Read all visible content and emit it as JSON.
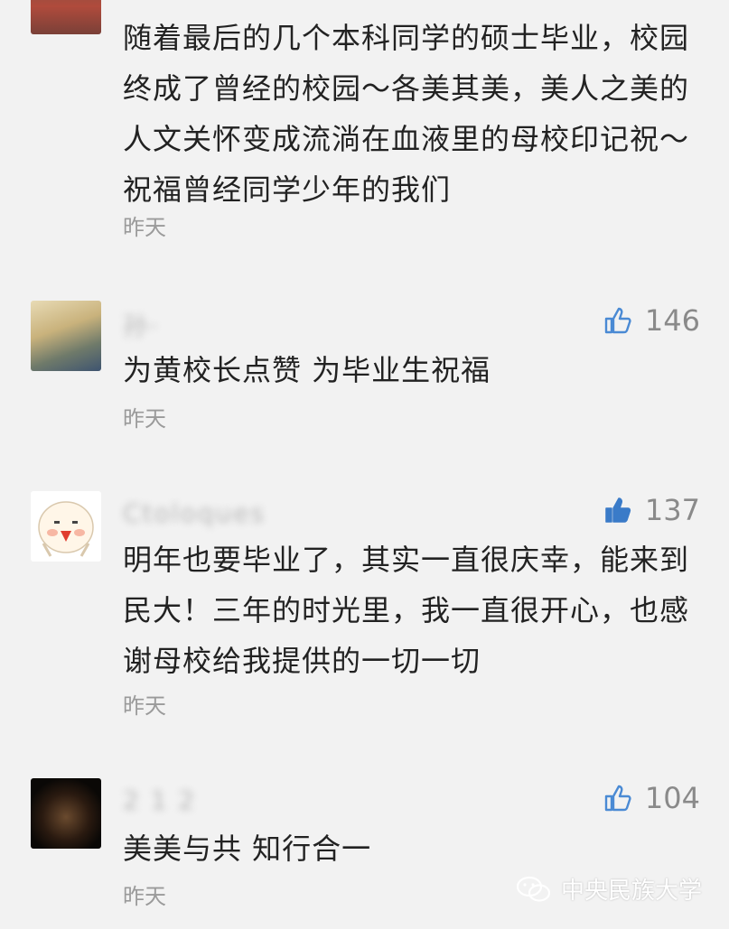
{
  "comments": [
    {
      "name": "",
      "likes": "",
      "text": "随着最后的几个本科同学的硕士毕业，校园终成了曾经的校园～各美其美，美人之美的人文关怀变成流淌在血液里的母校印记祝～祝福曾经同学少年的我们",
      "time": "昨天"
    },
    {
      "name": "孙·",
      "likes": "146",
      "text": "为黄校长点赞  为毕业生祝福",
      "time": "昨天"
    },
    {
      "name": "Ctoloques",
      "likes": "137",
      "text": "明年也要毕业了，其实一直很庆幸，能来到民大！三年的时光里，我一直很开心，也感谢母校给我提供的一切一切",
      "time": "昨天"
    },
    {
      "name": "2 1 2",
      "likes": "104",
      "text": "美美与共 知行合一",
      "time": "昨天"
    }
  ],
  "watermark": {
    "text": "中央民族大学"
  },
  "colors": {
    "like_filled": "#3a7bc8",
    "like_outline": "#4a8ad4",
    "background": "#f2f2f2"
  }
}
